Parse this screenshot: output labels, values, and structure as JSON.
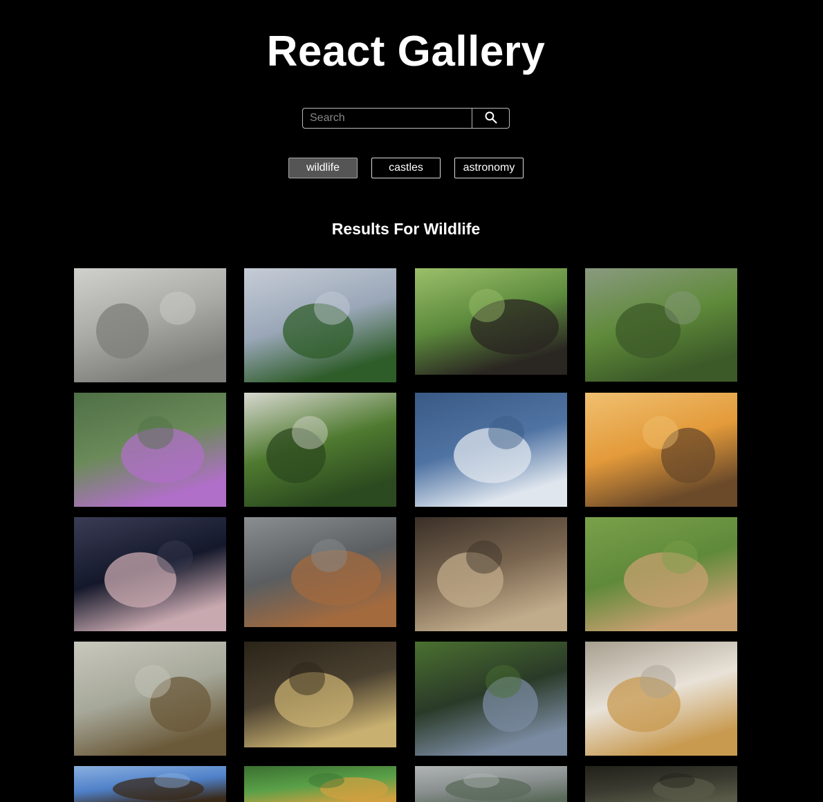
{
  "header": {
    "title": "React Gallery"
  },
  "search": {
    "placeholder": "Search",
    "button_icon": "search-icon"
  },
  "nav": {
    "buttons": [
      {
        "label": "wildlife",
        "active": true
      },
      {
        "label": "castles",
        "active": false
      },
      {
        "label": "astronomy",
        "active": false
      }
    ]
  },
  "results": {
    "heading": "Results For Wildlife"
  },
  "photos": [
    {
      "subject": "elephants",
      "colors": [
        "#a9a9a6",
        "#7d7d79",
        "#d0d0cc"
      ]
    },
    {
      "subject": "ibises-in-tree",
      "colors": [
        "#9aa7b8",
        "#2f5d2a",
        "#c6ccd6"
      ]
    },
    {
      "subject": "cormorants-in-branches",
      "colors": [
        "#5c8a3c",
        "#2a2622",
        "#9bbf6a"
      ]
    },
    {
      "subject": "vultures-on-fence",
      "colors": [
        "#5f8a3a",
        "#3c5a28",
        "#8a9a80"
      ]
    },
    {
      "subject": "bee-and-flower",
      "colors": [
        "#6b8a5a",
        "#b06fc8",
        "#4f7046"
      ]
    },
    {
      "subject": "grass-with-ruler",
      "colors": [
        "#4f7a30",
        "#2c4a1f",
        "#d8d8d0"
      ]
    },
    {
      "subject": "pelicans-in-flight",
      "colors": [
        "#4f73a3",
        "#dfe6ee",
        "#3a5a85"
      ]
    },
    {
      "subject": "chickadee",
      "colors": [
        "#e39a3a",
        "#6b4a2a",
        "#f0c070"
      ]
    },
    {
      "subject": "mudflat-with-birds",
      "colors": [
        "#14182a",
        "#c9a9b0",
        "#3a3c55"
      ]
    },
    {
      "subject": "stonechat",
      "colors": [
        "#5a5e60",
        "#a36a3e",
        "#8a8e90"
      ]
    },
    {
      "subject": "gecko",
      "colors": [
        "#7a6650",
        "#c0ab8a",
        "#3a3028"
      ]
    },
    {
      "subject": "mountain-goat",
      "colors": [
        "#5f8a3a",
        "#c8a070",
        "#7aa04a"
      ]
    },
    {
      "subject": "warbler-on-branch",
      "colors": [
        "#a6a89a",
        "#6b5a3a",
        "#c8c8bc"
      ]
    },
    {
      "subject": "turtle",
      "colors": [
        "#4a4030",
        "#c8b070",
        "#2a2418"
      ]
    },
    {
      "subject": "heron",
      "colors": [
        "#2a3a28",
        "#7a8aa0",
        "#4a7030"
      ]
    },
    {
      "subject": "jaguar",
      "colors": [
        "#e8e2d8",
        "#c89a50",
        "#a8a090"
      ]
    },
    {
      "subject": "eagle-in-flight",
      "colors": [
        "#4f80c8",
        "#3a2a1a",
        "#8ab0e0"
      ]
    },
    {
      "subject": "yellow-bird",
      "colors": [
        "#5aa048",
        "#d0a040",
        "#3a7030"
      ]
    },
    {
      "subject": "misty-forest",
      "colors": [
        "#8a9090",
        "#5a6a5a",
        "#b0b4b4"
      ]
    },
    {
      "subject": "forest-floor",
      "colors": [
        "#3a3a30",
        "#5a5a48",
        "#22221a"
      ]
    }
  ]
}
